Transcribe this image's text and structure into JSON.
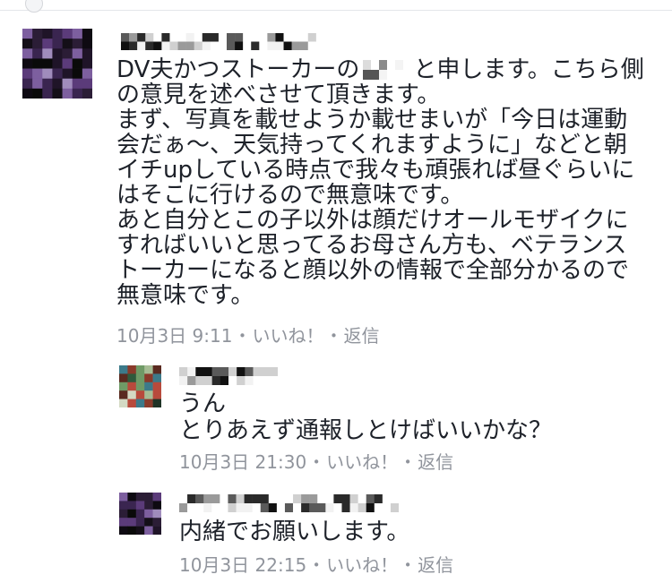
{
  "separator": "・",
  "comments": [
    {
      "line1_before": "DV夫かつストーカーの",
      "line1_after": "と申します。こちら側",
      "lines": [
        "の意見を述べさせて頂きます。",
        "まず、写真を載せようか載せまいが「今日は運動",
        "会だぁ〜、天気持ってくれますように」などと朝",
        "イチupしている時点で我々も頑張れば昼ぐらいに",
        "はそこに行けるので無意味です。",
        "あと自分とこの子以外は顔だけオールモザイクに",
        "すればいいと思ってるお母さん方も、ベテランス",
        "トーカーになると顔以外の情報で全部分かるので",
        "無意味です。"
      ],
      "timestamp": "10月3日 9:11",
      "like": "いいね！",
      "reply": "返信"
    },
    {
      "lines": [
        "うん",
        "とりあえず通報しとけばいいかな？"
      ],
      "timestamp": "10月3日 21:30",
      "like": "いいね！",
      "reply": "返信"
    },
    {
      "lines": [
        "内緒でお願いします。"
      ],
      "timestamp": "10月3日 22:15",
      "like": "いいね！",
      "reply": "返信"
    }
  ]
}
